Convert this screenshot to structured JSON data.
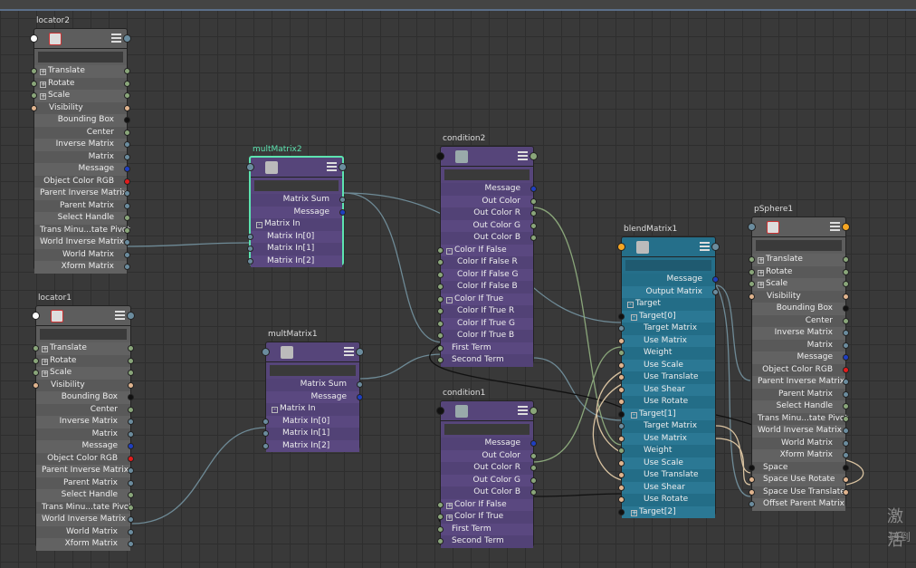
{
  "colors": {
    "gray_node": "#5d5d5d",
    "purple_node": "#56457a",
    "teal_node": "#256f8a",
    "selected_outline": "#5de3b0",
    "wire": "#6e8a96",
    "wire_tan": "#d8c2a0",
    "plug_matrix": "#6b8c9e",
    "plug_msg": "#1f3fc0",
    "plug_num": "#8aa67a",
    "plug_bool": "#e0b48e",
    "plug_rgb": "#e21b1b",
    "plug_black": "#111111"
  },
  "nodes": {
    "locator2": {
      "title": "locator2",
      "rows": [
        "Translate",
        "Rotate",
        "Scale",
        "Visibility",
        "Bounding Box",
        "Center",
        "Inverse Matrix",
        "Matrix",
        "Message",
        "Object Color RGB",
        "Parent Inverse Matrix",
        "Parent Matrix",
        "Select Handle",
        "Trans Minu...tate Pivot",
        "World Inverse Matrix",
        "World Matrix",
        "Xform Matrix"
      ]
    },
    "locator1": {
      "title": "locator1",
      "rows": [
        "Translate",
        "Rotate",
        "Scale",
        "Visibility",
        "Bounding Box",
        "Center",
        "Inverse Matrix",
        "Matrix",
        "Message",
        "Object Color RGB",
        "Parent Inverse Matrix",
        "Parent Matrix",
        "Select Handle",
        "Trans Minu...tate Pivot",
        "World Inverse Matrix",
        "World Matrix",
        "Xform Matrix"
      ]
    },
    "multMatrix2": {
      "title": "multMatrix2",
      "rows": [
        "Matrix Sum",
        "Message",
        "Matrix In",
        "Matrix In[0]",
        "Matrix In[1]",
        "Matrix In[2]"
      ]
    },
    "multMatrix1": {
      "title": "multMatrix1",
      "rows": [
        "Matrix Sum",
        "Message",
        "Matrix In",
        "Matrix In[0]",
        "Matrix In[1]",
        "Matrix In[2]"
      ]
    },
    "condition2": {
      "title": "condition2",
      "rows": [
        "Message",
        "Out Color",
        "Out Color R",
        "Out Color G",
        "Out Color B",
        "Color If False",
        "Color If False R",
        "Color If False G",
        "Color If False B",
        "Color If True",
        "Color If True R",
        "Color If True G",
        "Color If True B",
        "First Term",
        "Second Term"
      ]
    },
    "condition1": {
      "title": "condition1",
      "rows": [
        "Message",
        "Out Color",
        "Out Color R",
        "Out Color G",
        "Out Color B",
        "Color If False",
        "Color If True",
        "First Term",
        "Second Term"
      ]
    },
    "blendMatrix1": {
      "title": "blendMatrix1",
      "rows": [
        "Message",
        "Output Matrix",
        "Target",
        "Target[0]",
        "Target Matrix",
        "Use Matrix",
        "Weight",
        "Use Scale",
        "Use Translate",
        "Use Shear",
        "Use Rotate",
        "Target[1]",
        "Target Matrix",
        "Use Matrix",
        "Weight",
        "Use Scale",
        "Use Translate",
        "Use Shear",
        "Use Rotate",
        "Target[2]"
      ]
    },
    "pSphere1": {
      "title": "pSphere1",
      "rows": [
        "Translate",
        "Rotate",
        "Scale",
        "Visibility",
        "Bounding Box",
        "Center",
        "Inverse Matrix",
        "Matrix",
        "Message",
        "Object Color RGB",
        "Parent Inverse Matrix",
        "Parent Matrix",
        "Select Handle",
        "Trans Minu...tate Pivot",
        "World Inverse Matrix",
        "World Matrix",
        "Xform Matrix",
        "Space",
        "Space Use Rotate",
        "Space Use Translate",
        "Offset Parent Matrix"
      ]
    }
  },
  "watermark": {
    "line1": "激活",
    "line2": "转到"
  }
}
